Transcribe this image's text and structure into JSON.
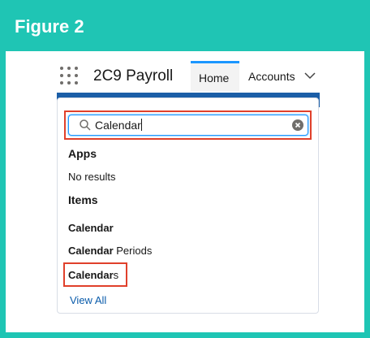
{
  "figure": {
    "title": "Figure 2"
  },
  "header": {
    "app_name": "2C9 Payroll",
    "tabs": [
      {
        "label": "Home",
        "active": true
      },
      {
        "label": "Accounts",
        "active": false
      }
    ],
    "waffle_icon": "app-launcher-icon"
  },
  "search": {
    "value": "Calendar",
    "icon": "search-icon",
    "clear_icon": "clear-icon"
  },
  "results": {
    "apps_heading": "Apps",
    "apps_empty": "No results",
    "items_heading": "Items",
    "items": [
      {
        "bold": "Calendar",
        "rest": ""
      },
      {
        "bold": "Calendar",
        "rest": " Periods"
      },
      {
        "bold": "Calendar",
        "rest": "s"
      }
    ],
    "view_all": "View All"
  },
  "colors": {
    "frame_teal": "#1fc5b4",
    "highlight_red": "#e0402b",
    "link_blue": "#0b5cab",
    "active_tab_border": "#1b96ff"
  }
}
